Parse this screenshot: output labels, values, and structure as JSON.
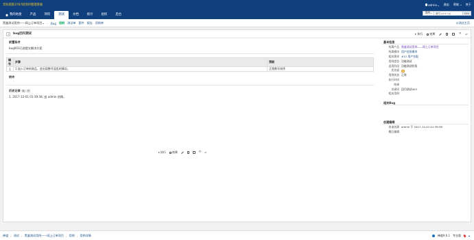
{
  "header": {
    "brand": "华科软职3787班项目管理系统",
    "user": "admin",
    "links": [
      "退出",
      "帮助",
      "关于"
    ],
    "nav": [
      "我的地盘",
      "产品",
      "项目",
      "测试",
      "文档",
      "统计",
      "组织",
      "后台"
    ],
    "active_nav": "测试",
    "search": {
      "select": "用例",
      "placeholder": "编号(ctrl+g)",
      "go": "GO!"
    }
  },
  "subnav": {
    "product": "黑盒测试用例——网上订单项目",
    "items": [
      "Bug",
      "用例",
      "测试单",
      "套件",
      "报告",
      "用例库"
    ],
    "active": "用例",
    "right": "公测试主页"
  },
  "case": {
    "title": "bug回归测试",
    "actions": [
      "执行",
      "结果"
    ],
    "precondition_label": "前置条件",
    "precondition": "bug003已经提交解决方案",
    "steps_header": [
      "编号",
      "步骤",
      "预期"
    ],
    "steps": [
      {
        "no": "1",
        "step": "1.加入订单的商品，会出现数号混乱的情况。",
        "expected": "正常数号排序"
      }
    ],
    "files_label": "附件",
    "history_label": "历史记录",
    "history": [
      "1. 2017-12-01 01:39:38, 由 admin 创建。"
    ]
  },
  "basic": {
    "title": "基本信息",
    "rows": [
      {
        "k": "所属产品",
        "v": "黑盒测试用例——网上订单项目",
        "style": "purple"
      },
      {
        "k": "所属模块",
        "v": "用户信息模块",
        "style": "link"
      },
      {
        "k": "相关需求",
        "v": "#12 用户名配",
        "style": "link"
      },
      {
        "k": "用例类型",
        "v": "功能测试",
        "style": ""
      },
      {
        "k": "适用阶段",
        "v": "功能测试阶段",
        "style": ""
      },
      {
        "k": "优先级",
        "v": "",
        "style": "pri"
      },
      {
        "k": "用例状态",
        "v": "正常",
        "style": ""
      },
      {
        "k": "执行时间",
        "v": "",
        "style": ""
      },
      {
        "k": "结果",
        "v": "",
        "style": ""
      },
      {
        "k": "关键词",
        "v": "回归测试003",
        "style": ""
      },
      {
        "k": "相关用例",
        "v": "",
        "style": ""
      }
    ],
    "priority": "3"
  },
  "related_bug": {
    "title": "相关Bug"
  },
  "create_edit": {
    "title": "创建编辑",
    "rows": [
      {
        "k": "由谁创建",
        "v": "admin 于 2017-12-01 01:39:38"
      },
      {
        "k": "最后编辑",
        "v": ""
      }
    ]
  },
  "footer": {
    "crumbs": [
      "禅道",
      "测试",
      "黑盒测试用例——网上订单项目",
      "用例",
      "用例详情"
    ],
    "version": "禅道9.6.1",
    "mode": "专业版"
  }
}
